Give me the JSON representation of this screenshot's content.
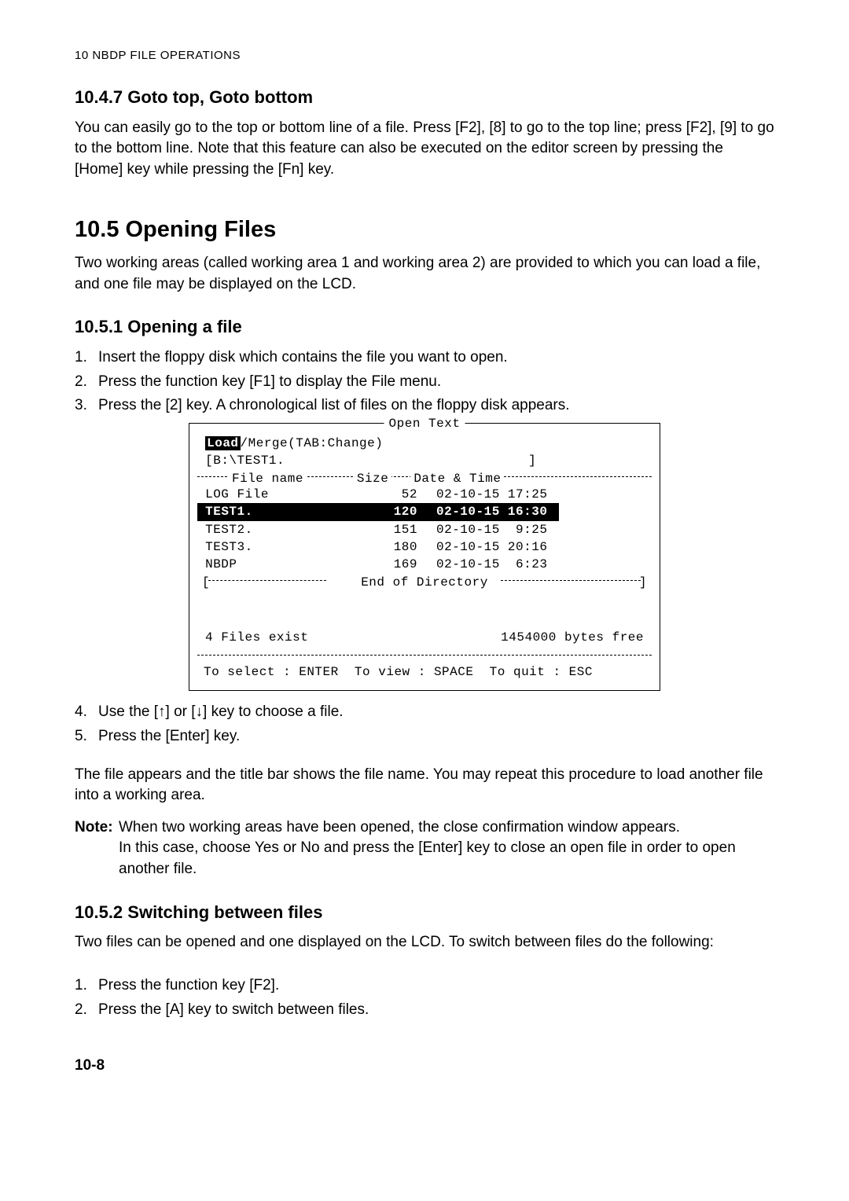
{
  "page_header": "10   NBDP FILE OPERATIONS",
  "s1047": {
    "title": "10.4.7 Goto top, Goto bottom",
    "para": "You can easily go to the top or bottom line of a file. Press [F2], [8] to go to the top line; press [F2], [9] to go to the bottom line. Note that this feature can also be executed on the editor screen by pressing the [Home] key while pressing the [Fn] key."
  },
  "s105": {
    "title": "10.5 Opening Files",
    "para": "Two working areas (called working area 1 and working area 2) are provided to which you can load a file, and one file may be displayed on the LCD."
  },
  "s1051": {
    "title": "10.5.1 Opening a file",
    "steps": [
      "Insert the floppy disk which contains the file you want to open.",
      "Press the function key [F1] to display the File menu.",
      "Press the [2] key. A chronological list of files on the floppy disk appears."
    ],
    "step4": "Use the [↑] or [↓] key to choose a file.",
    "step5": "Press the [Enter] key.",
    "para_after": "The file appears and the title bar shows the file name. You may repeat this procedure to load another file into a working area.",
    "note_label": "Note:",
    "note_text_l1": "When two working areas have been opened, the close confirmation window appears.",
    "note_text_l2": "In this case, choose Yes or No and press the [Enter] key to close an open file in order to open another file."
  },
  "terminal": {
    "title": " Open Text ",
    "load_label": "Load",
    "merge_label": "/Merge(TAB:Change)",
    "path_open": "[B:\\TEST1.",
    "path_close": "]",
    "header_cols": {
      "file": "File name",
      "size": "Size",
      "date": "Date & Time"
    },
    "rows": [
      {
        "name": " LOG File",
        "size": "52",
        "date": "02-10-15 17:25",
        "hl": false
      },
      {
        "name": " TEST1.",
        "size": "120",
        "date": "02-10-15 16:30",
        "hl": true
      },
      {
        "name": " TEST2.",
        "size": "151",
        "date": "02-10-15  9:25",
        "hl": false
      },
      {
        "name": " TEST3.",
        "size": "180",
        "date": "02-10-15 20:16",
        "hl": false
      },
      {
        "name": " NBDP",
        "size": "169",
        "date": "02-10-15  6:23",
        "hl": false
      }
    ],
    "end_dir_open": "[",
    "end_dir_text": " End of Directory ",
    "end_dir_close": "]",
    "files_exist": "4 Files exist",
    "bytes_free": "1454000 bytes free",
    "footer": "To select : ENTER  To view : SPACE  To quit : ESC"
  },
  "s1052": {
    "title": "10.5.2 Switching between files",
    "para": "Two files can be opened and one displayed on the LCD. To switch between files do the following:",
    "steps": [
      "Press the function key [F2].",
      "Press the [A] key to switch between files."
    ]
  },
  "page_number": "10-8"
}
